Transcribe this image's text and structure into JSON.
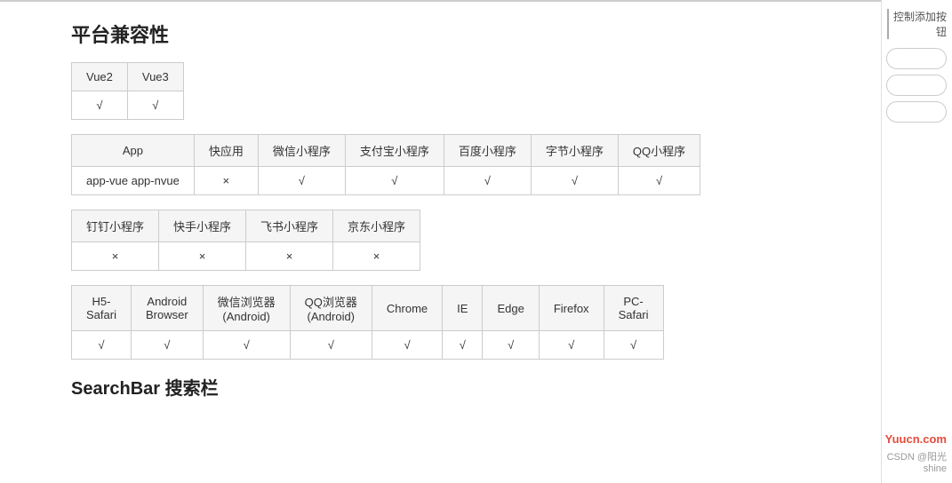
{
  "page": {
    "section1_title": "平台兼容性",
    "section2_title": "SearchBar 搜索栏",
    "table1": {
      "headers": [
        "Vue2",
        "Vue3"
      ],
      "rows": [
        [
          "√",
          "√"
        ]
      ]
    },
    "table2": {
      "headers": [
        "App",
        "快应用",
        "微信小程序",
        "支付宝小程序",
        "百度小程序",
        "字节小程序",
        "QQ小程序"
      ],
      "rows": [
        [
          "app-vue app-nvue",
          "×",
          "√",
          "√",
          "√",
          "√",
          "√"
        ]
      ]
    },
    "table3": {
      "headers": [
        "钉钉小程序",
        "快手小程序",
        "飞书小程序",
        "京东小程序"
      ],
      "rows": [
        [
          "×",
          "×",
          "×",
          "×"
        ]
      ]
    },
    "table4": {
      "headers": [
        "H5-\nSafari",
        "Android\nBrowser",
        "微信浏览器\n(Android)",
        "QQ浏览器\n(Android)",
        "Chrome",
        "IE",
        "Edge",
        "Firefox",
        "PC-\nSafari"
      ],
      "rows": [
        [
          "√",
          "√",
          "√",
          "√",
          "√",
          "√",
          "√",
          "√",
          "√"
        ]
      ]
    },
    "sidebar": {
      "label": "控制添加按钮",
      "inputs": [
        "",
        "",
        ""
      ]
    },
    "watermark": {
      "yuucn": "Yuucn.com",
      "csdn": "CSDN @阳光shine"
    }
  }
}
